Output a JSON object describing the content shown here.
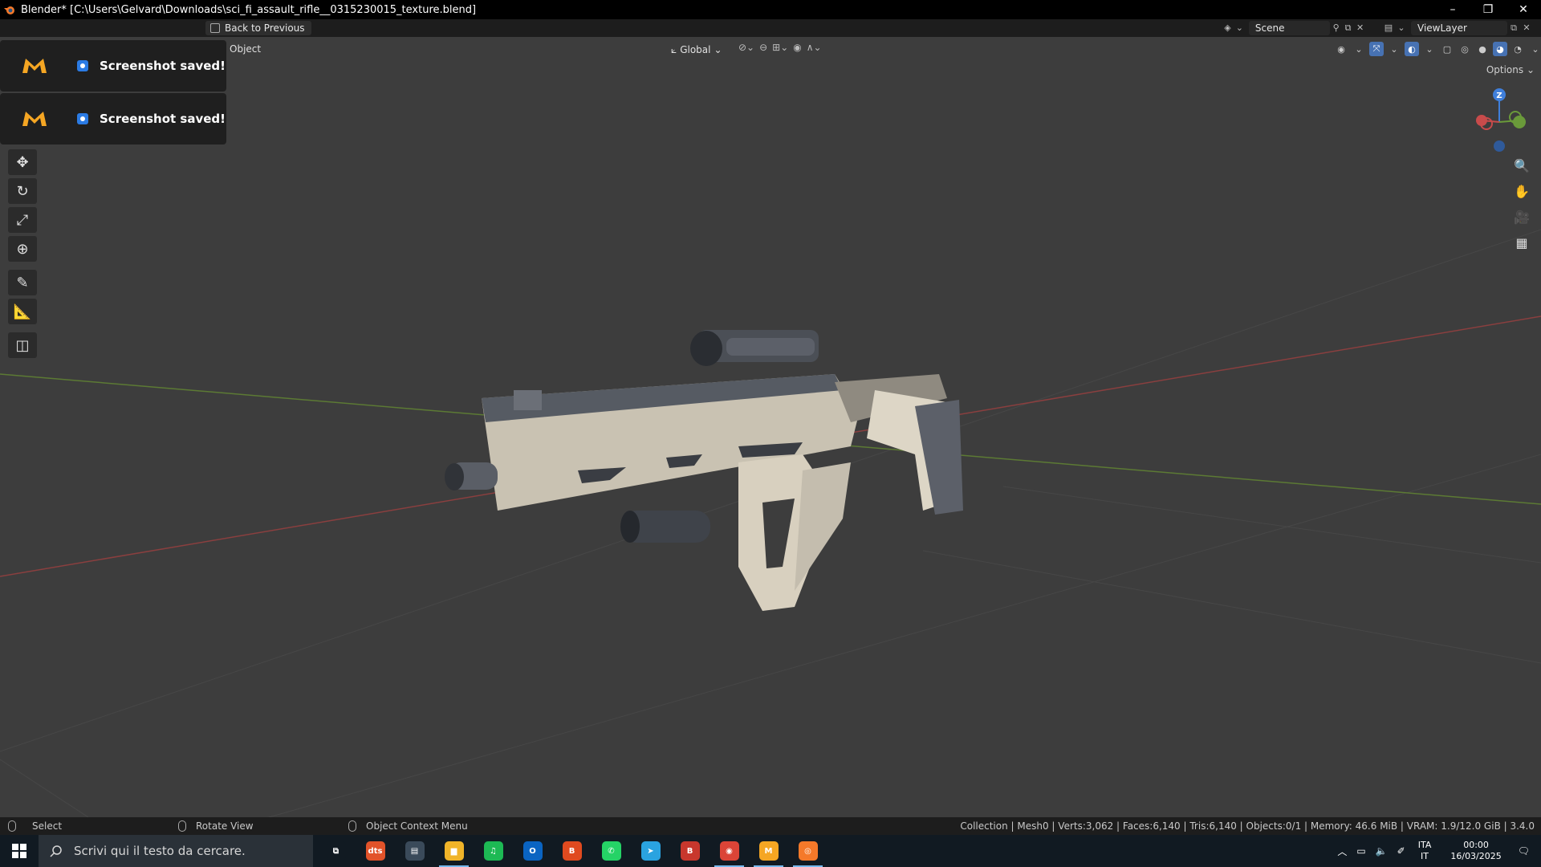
{
  "window": {
    "title": "Blender* [C:\\Users\\Gelvard\\Downloads\\sci_fi_assault_rifle__0315230015_texture.blend]",
    "minimize": "–",
    "restore": "❐",
    "close": "✕"
  },
  "topbar": {
    "back_label": "Back to Previous",
    "scene_label": "Scene",
    "viewlayer_label": "ViewLayer"
  },
  "viewport_header": {
    "mode_menu": "Object",
    "orientation": "Global",
    "options_label": "Options"
  },
  "toasts": [
    {
      "message": "Screenshot saved!"
    },
    {
      "message": "Screenshot saved!"
    }
  ],
  "gizmo": {
    "z_label": "Z"
  },
  "statusbar": {
    "select": "Select",
    "rotate": "Rotate View",
    "context_menu": "Object Context Menu",
    "stats": "Collection | Mesh0 | Verts:3,062 | Faces:6,140 | Tris:6,140 | Objects:0/1 | Memory: 46.6 MiB | VRAM: 1.9/12.0 GiB | 3.4.0"
  },
  "taskbar": {
    "search_placeholder": "Scrivi qui il testo da cercare.",
    "apps": [
      {
        "name": "task-view",
        "label": "⧉",
        "color": "#111a22"
      },
      {
        "name": "dts",
        "label": "dts",
        "color": "#e2532a"
      },
      {
        "name": "explorer-alt",
        "label": "▤",
        "color": "#3a4a5a"
      },
      {
        "name": "file-explorer",
        "label": "▆",
        "color": "#f0b429"
      },
      {
        "name": "spotify",
        "label": "♫",
        "color": "#1db954"
      },
      {
        "name": "outlook",
        "label": "O",
        "color": "#0a64c2"
      },
      {
        "name": "brave",
        "label": "B",
        "color": "#e04a1f"
      },
      {
        "name": "whatsapp",
        "label": "✆",
        "color": "#25d366"
      },
      {
        "name": "telegram",
        "label": "➤",
        "color": "#2aa3e0"
      },
      {
        "name": "brave-alt",
        "label": "B",
        "color": "#c8372d"
      },
      {
        "name": "chrome",
        "label": "◉",
        "color": "#db4437"
      },
      {
        "name": "miro-app",
        "label": "M",
        "color": "#f5a623"
      },
      {
        "name": "blender",
        "label": "◎",
        "color": "#f5792a"
      }
    ],
    "lang_top": "ITA",
    "lang_bottom": "IT",
    "time": "00:00",
    "date": "16/03/2025"
  },
  "colors": {
    "accent": "#4772b3",
    "x_axis": "#c84b4b",
    "y_axis": "#6a9a3a",
    "z_axis": "#3f7fdb"
  }
}
